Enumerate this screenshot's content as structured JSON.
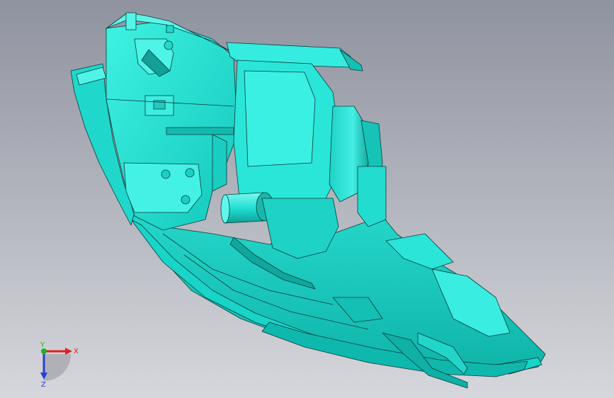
{
  "viewport": {
    "background_top": "#8f939f",
    "background_bottom": "#d6d7dc",
    "model_color": "#22e6d6",
    "model_light": "#55f6e8",
    "model_dark": "#0fa7a0",
    "edge_color": "#0b3b3b"
  },
  "triad": {
    "x_label": "X",
    "y_label": "Y",
    "z_label": "Z",
    "x_color": "#e0201c",
    "y_color": "#1fb31f",
    "z_color": "#2740d8"
  }
}
